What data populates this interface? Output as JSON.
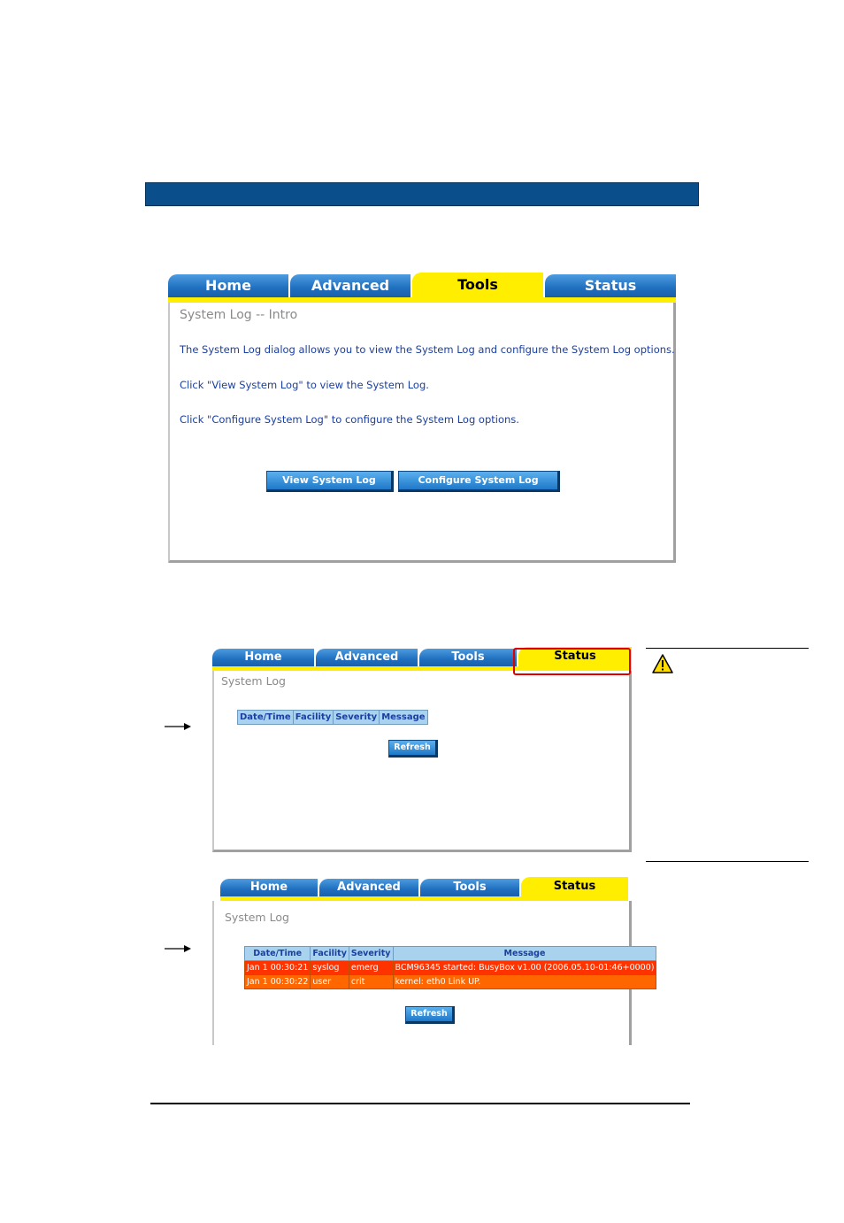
{
  "tabs_main": [
    {
      "label": "Home",
      "active": false
    },
    {
      "label": "Advanced",
      "active": false
    },
    {
      "label": "Tools",
      "active": true
    },
    {
      "label": "Status",
      "active": false
    }
  ],
  "intro": {
    "heading": "System Log -- Intro",
    "paragraphs": [
      "The System Log dialog allows you to view the System Log and configure the System Log options.",
      "Click \"View System Log\" to view the System Log.",
      "Click \"Configure System Log\" to configure the System Log options."
    ],
    "view_button": "View System Log",
    "configure_button": "Configure System Log"
  },
  "tabs_log": [
    {
      "label": "Home",
      "active": false
    },
    {
      "label": "Advanced",
      "active": false
    },
    {
      "label": "Tools",
      "active": false
    },
    {
      "label": "Status",
      "active": true
    }
  ],
  "log_empty": {
    "heading": "System Log",
    "columns": [
      "Date/Time",
      "Facility",
      "Severity",
      "Message"
    ],
    "refresh_button": "Refresh"
  },
  "log_filled": {
    "heading": "System Log",
    "columns": [
      "Date/Time",
      "Facility",
      "Severity",
      "Message"
    ],
    "rows": [
      {
        "datetime": "Jan 1 00:30:21",
        "facility": "syslog",
        "severity": "emerg",
        "message": "BCM96345 started: BusyBox v1.00 (2006.05.10-01:46+0000)",
        "color": "#ff3300"
      },
      {
        "datetime": "Jan 1 00:30:22",
        "facility": "user",
        "severity": "crit",
        "message": "kernel: eth0 Link UP.",
        "color": "#ff6600"
      }
    ],
    "refresh_button": "Refresh"
  },
  "colors": {
    "title_bar": "#0a4f8c",
    "tab_blue": "#1f6fbf",
    "tab_active": "#ffee00",
    "highlight_box": "#e00000"
  }
}
